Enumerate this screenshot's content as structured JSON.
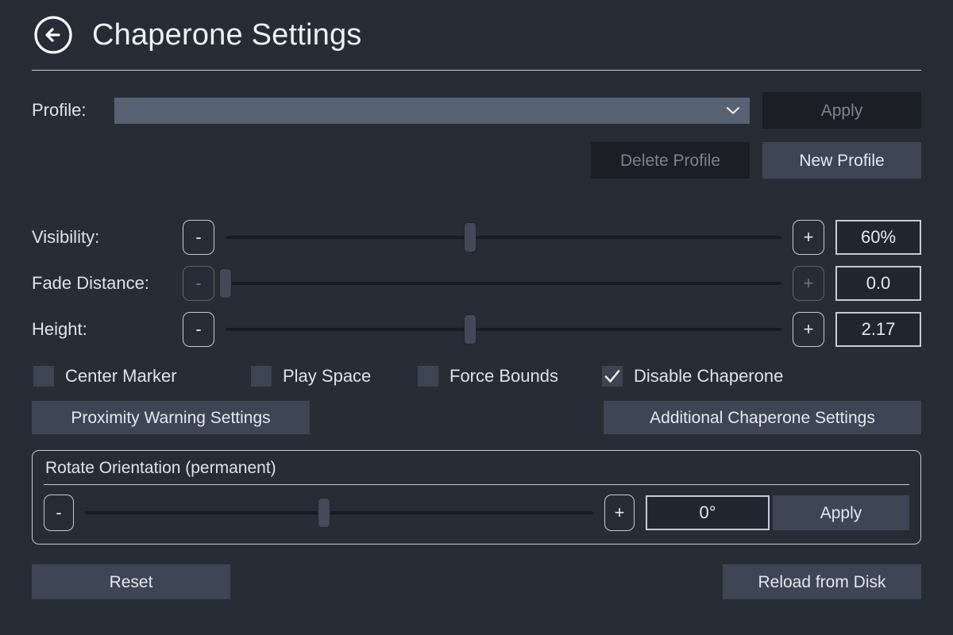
{
  "header": {
    "back_icon": "arrow-left-circle-icon",
    "title": "Chaperone Settings"
  },
  "profile": {
    "label": "Profile:",
    "selected_value": "",
    "placeholder": "",
    "chevron_icon": "chevron-down-icon",
    "apply_label": "Apply",
    "apply_disabled": true,
    "delete_label": "Delete Profile",
    "delete_disabled": true,
    "new_label": "New Profile",
    "new_disabled": false
  },
  "sliders": [
    {
      "label": "Visibility:",
      "minus_label": "-",
      "plus_label": "+",
      "value": "60%",
      "percent": 44,
      "disabled": false
    },
    {
      "label": "Fade Distance:",
      "minus_label": "-",
      "plus_label": "+",
      "value": "0.0",
      "percent": 0,
      "disabled": true
    },
    {
      "label": "Height:",
      "minus_label": "-",
      "plus_label": "+",
      "value": "2.17",
      "percent": 44,
      "disabled": false
    }
  ],
  "checkboxes": [
    {
      "label": "Center Marker",
      "checked": false
    },
    {
      "label": "Play Space",
      "checked": false
    },
    {
      "label": "Force Bounds",
      "checked": false
    },
    {
      "label": "Disable Chaperone",
      "checked": true
    }
  ],
  "settings_buttons": {
    "proximity_label": "Proximity Warning Settings",
    "additional_label": "Additional Chaperone Settings"
  },
  "rotate_group": {
    "title": "Rotate Orientation (permanent)",
    "minus_label": "-",
    "plus_label": "+",
    "value": "0°",
    "percent": 47,
    "apply_label": "Apply"
  },
  "footer": {
    "reset_label": "Reset",
    "reload_label": "Reload from Disk"
  },
  "colors": {
    "background": "#282c34",
    "button": "#3e4554",
    "button_disabled": "#1b1e25",
    "combo": "#596273",
    "text": "#dfe3ea",
    "text_disabled": "#7c8291",
    "border": "#c6cbd6",
    "slider_track": "#181b21",
    "slider_handle": "#434a5a",
    "checkbox": "#3d4452"
  }
}
